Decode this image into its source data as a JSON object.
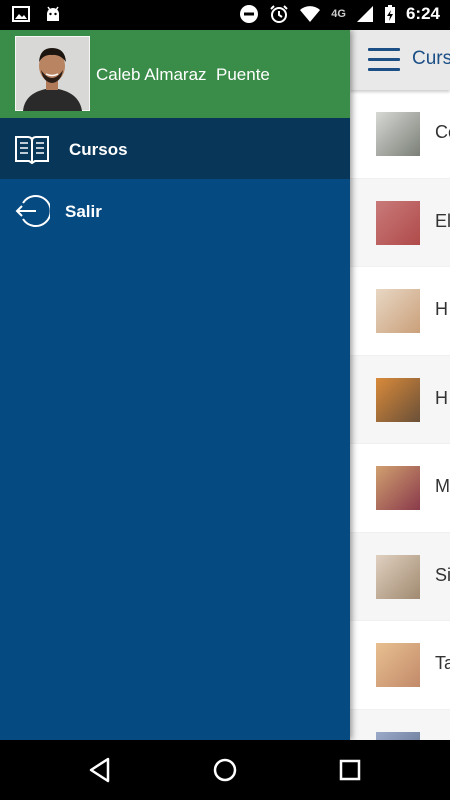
{
  "status_bar": {
    "time": "6:24",
    "network": "4G",
    "icons": [
      "image-icon",
      "android-icon",
      "minus-circle-icon",
      "alarm-icon",
      "wifi-icon",
      "signal-icon",
      "battery-charging-icon"
    ]
  },
  "drawer": {
    "user_name": "Caleb Almaraz  Puente",
    "items": [
      {
        "label": "Cursos",
        "icon": "book-icon"
      },
      {
        "label": "Salir",
        "icon": "logout-icon"
      }
    ]
  },
  "toolbar": {
    "title": "Curs"
  },
  "courses": [
    {
      "label": "Co",
      "thumb": "#7a7f77"
    },
    {
      "label": "El",
      "thumb": "#b04a4a"
    },
    {
      "label": "H",
      "thumb": "#caa07a"
    },
    {
      "label": "H",
      "thumb": "#6a5038"
    },
    {
      "label": "M",
      "thumb": "#8a3a4a"
    },
    {
      "label": "Si",
      "thumb": "#a08a70"
    },
    {
      "label": "Ta",
      "thumb": "#c28a6a"
    },
    {
      "label": "",
      "thumb": "#5a6a88"
    }
  ],
  "colors": {
    "drawer_bg": "#064a82",
    "header_bg": "#3a8c49",
    "selected_bg": "#073658",
    "accent": "#1c4f86"
  },
  "nav": [
    "back-icon",
    "home-icon",
    "recents-icon"
  ]
}
